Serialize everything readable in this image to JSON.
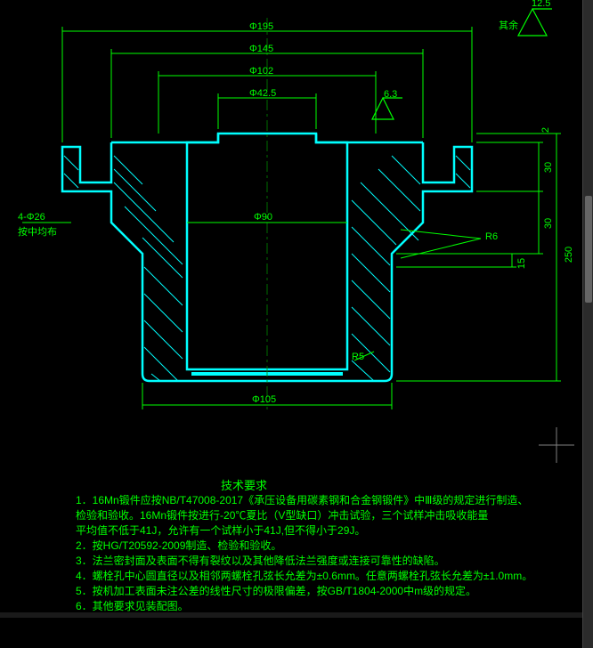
{
  "dimensions": {
    "d195": "Φ195",
    "d145": "Φ145",
    "d102": "Φ102",
    "d42_5": "Φ42.5",
    "d90": "Φ90",
    "d105": "Φ105",
    "h250": "250",
    "h30_top": "30",
    "h30_mid": "30",
    "h15": "15",
    "h2": "2",
    "holes": "4-Φ26",
    "holes_note": "按中均布",
    "r6": "R6",
    "r5": "R5"
  },
  "roughness": {
    "general_prefix": "其余",
    "general_value": "12.5",
    "local_value": "6.3"
  },
  "notes": {
    "title": "技术要求",
    "lines": [
      "1．16Mn锻件应按NB/T47008-2017《承压设备用碳素钢和合金钢锻件》中Ⅲ级的规定进行制造、",
      "   检验和验收。16Mn锻件按进行-20℃夏比（V型缺口）冲击试验，三个试样冲击吸收能量",
      "   平均值不低于41J，允许有一个试样小于41J,但不得小于29J。",
      "2．按HG/T20592-2009制造、检验和验收。",
      "3．法兰密封面及表面不得有裂纹以及其他降低法兰强度或连接可靠性的缺陷。",
      "4．螺栓孔中心圆直径以及相邻两螺栓孔弦长允差为±0.6mm。任意两螺栓孔弦长允差为±1.0mm。",
      "5．按机加工表面未注公差的线性尺寸的极限偏差，按GB/T1804-2000中m级的规定。",
      "6．其他要求见装配图。"
    ]
  },
  "colors": {
    "bg": "#000000",
    "outline": "#00ffff",
    "dims": "#00ff00",
    "hatch": "#00ffff",
    "ucs": "#666666"
  },
  "chart_data": {
    "type": "table",
    "description": "Engineering CAD cross-section drawing of a machined flange part",
    "diameters_mm": {
      "Φ195": 195,
      "Φ145": 145,
      "Φ102": 102,
      "Φ42.5": 42.5,
      "Φ90": 90,
      "Φ105": 105
    },
    "heights_mm": {
      "overall": 250,
      "step_top": 30,
      "step_mid": 30,
      "step_lower": 15,
      "top_clear": 2
    },
    "radii_mm": {
      "R6": 6,
      "R5": 5
    },
    "bolt_holes": {
      "count": 4,
      "dia_mm": 26,
      "pattern": "evenly distributed on circle"
    },
    "surface_roughness_Ra": {
      "general": 12.5,
      "local": 6.3
    },
    "material": "16Mn forging per NB/T47008-2017 grade III"
  }
}
